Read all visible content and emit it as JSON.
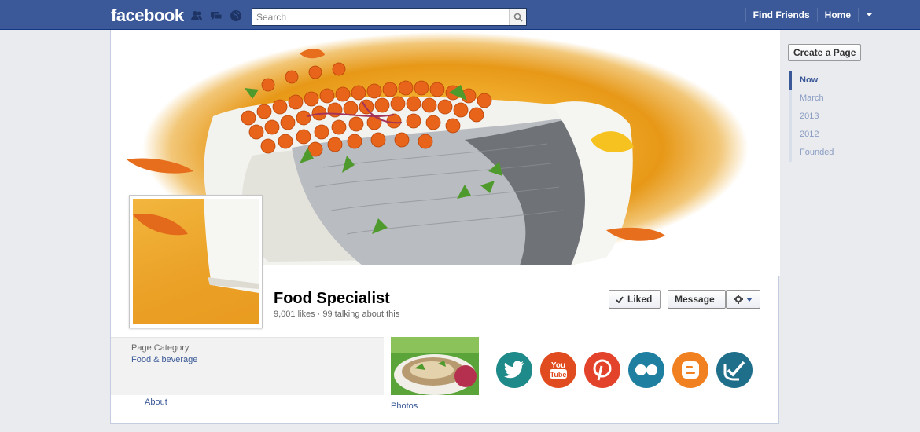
{
  "topbar": {
    "logo": "facebook",
    "search_placeholder": "Search",
    "nav": [
      {
        "label": "Find Friends"
      },
      {
        "label": "Home"
      }
    ]
  },
  "page": {
    "name": "Food Specialist",
    "likes": "9,001 likes",
    "talking": "99 talking about this",
    "liked_label": "Liked",
    "message_label": "Message",
    "category_label": "Page Category",
    "category_value": "Food & beverage",
    "about_label": "About",
    "photos_label": "Photos"
  },
  "social": [
    {
      "icon": "twitter-icon",
      "color": "#1e8a8a"
    },
    {
      "icon": "youtube-icon",
      "color": "#e04c1f",
      "label": "You Tube"
    },
    {
      "icon": "pinterest-icon",
      "color": "#e2432a"
    },
    {
      "icon": "flickr-icon",
      "color": "#1e7fa0"
    },
    {
      "icon": "blogger-icon",
      "color": "#f08020"
    },
    {
      "icon": "foursquare-icon",
      "color": "#1f6f8b"
    }
  ],
  "rail": {
    "create_page": "Create a Page",
    "timeline": [
      {
        "label": "Now",
        "active": true
      },
      {
        "label": "March"
      },
      {
        "label": "2013"
      },
      {
        "label": "2012"
      },
      {
        "label": "Founded"
      }
    ]
  },
  "colors": {
    "brand": "#3b5998",
    "link": "#3b5998"
  }
}
